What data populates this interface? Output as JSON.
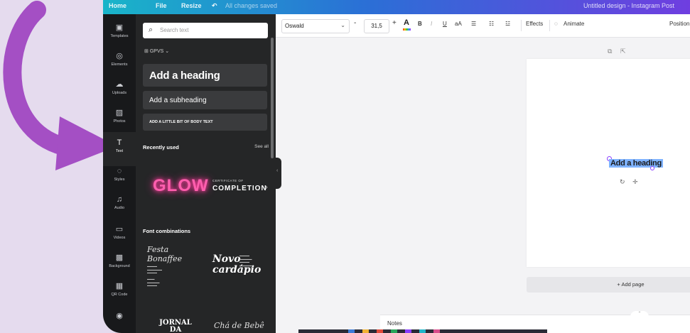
{
  "topbar": {
    "home": "Home",
    "file": "File",
    "resize": "Resize",
    "saved": "All changes saved",
    "design_title": "Untitled design - Instagram Post"
  },
  "rail": {
    "items": [
      {
        "label": "Templates",
        "icon": "templates-icon"
      },
      {
        "label": "Elements",
        "icon": "elements-icon"
      },
      {
        "label": "Uploads",
        "icon": "uploads-icon"
      },
      {
        "label": "Photos",
        "icon": "photos-icon"
      },
      {
        "label": "Text",
        "icon": "text-icon"
      },
      {
        "label": "Styles",
        "icon": "styles-icon"
      },
      {
        "label": "Audio",
        "icon": "audio-icon"
      },
      {
        "label": "Videos",
        "icon": "videos-icon"
      },
      {
        "label": "Background",
        "icon": "background-icon"
      },
      {
        "label": "QR Code",
        "icon": "qr-code-icon"
      }
    ],
    "active": "Text"
  },
  "panel": {
    "search_placeholder": "Search text",
    "brand_kit": "GPVS",
    "add_heading": "Add a heading",
    "add_subheading": "Add a subheading",
    "add_body": "Add a little bit of body text",
    "recently_used": "Recently used",
    "see_all": "See all",
    "glow": "GLOW",
    "certificate_small": "CERTIFICATE OF",
    "certificate_big": "COMPLETION",
    "font_combinations": "Font combinations",
    "combo1_title": "Festa Bonaffee",
    "combo2_title": "Novo cardápio",
    "jornal": "JORNAL DA CIDADE",
    "cha": "Chá de Bebê"
  },
  "toolbar": {
    "font": "Oswald",
    "minus": "-",
    "font_size": "31,5",
    "plus": "+",
    "bold": "B",
    "italic": "I",
    "underline": "U",
    "case": "aA",
    "effects": "Effects",
    "animate": "Animate",
    "position": "Position"
  },
  "canvas": {
    "selected_text": "Add a heading",
    "add_page": "+ Add page"
  },
  "bottombar": {
    "notes": "Notes"
  },
  "colors": {
    "accent": "#8b3dff",
    "rail_bg": "#18191b",
    "panel_bg": "#252627",
    "arrow": "#a44fc4",
    "glow": "#ff5fae"
  }
}
